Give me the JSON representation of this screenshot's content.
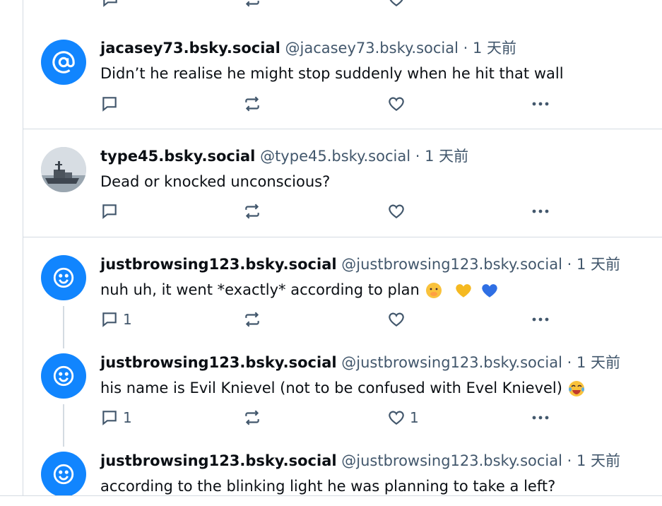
{
  "posts": [
    {
      "display_name": "jacasey73.bsky.social",
      "handle": "@jacasey73.bsky.social",
      "time": "· 1 天前",
      "text": "Didn’t he realise he might stop suddenly when he hit that wall",
      "replies": "",
      "likes": "",
      "avatar": "at-sign-icon"
    },
    {
      "display_name": "type45.bsky.social",
      "handle": "@type45.bsky.social",
      "time": "· 1 天前",
      "text": "Dead or knocked unconscious?",
      "replies": "",
      "likes": "",
      "avatar": "warship-photo"
    },
    {
      "display_name": "justbrowsing123.bsky.social",
      "handle": "@justbrowsing123.bsky.social",
      "time": "· 1 天前",
      "text": "nuh uh, it went *exactly* according to plan",
      "replies": "1",
      "likes": "",
      "avatar": "smiley-icon",
      "emojis": [
        "face-with-hand-over-mouth",
        "yellow-heart",
        "blue-heart"
      ]
    },
    {
      "display_name": "justbrowsing123.bsky.social",
      "handle": "@justbrowsing123.bsky.social",
      "time": "· 1 天前",
      "text": "his name is Evil Knievel (not to be confused with Evel Knievel)",
      "replies": "1",
      "likes": "1",
      "avatar": "smiley-icon",
      "emojis": [
        "face-with-tears-of-joy"
      ]
    },
    {
      "display_name": "justbrowsing123.bsky.social",
      "handle": "@justbrowsing123.bsky.social",
      "time": "· 1 天前",
      "text": "according to the blinking light he was planning to take a left?",
      "replies": "",
      "likes": "",
      "avatar": "smiley-icon"
    }
  ],
  "colors": {
    "accent": "#1185fe",
    "muted": "#42576c",
    "border": "#d4dbe2"
  }
}
